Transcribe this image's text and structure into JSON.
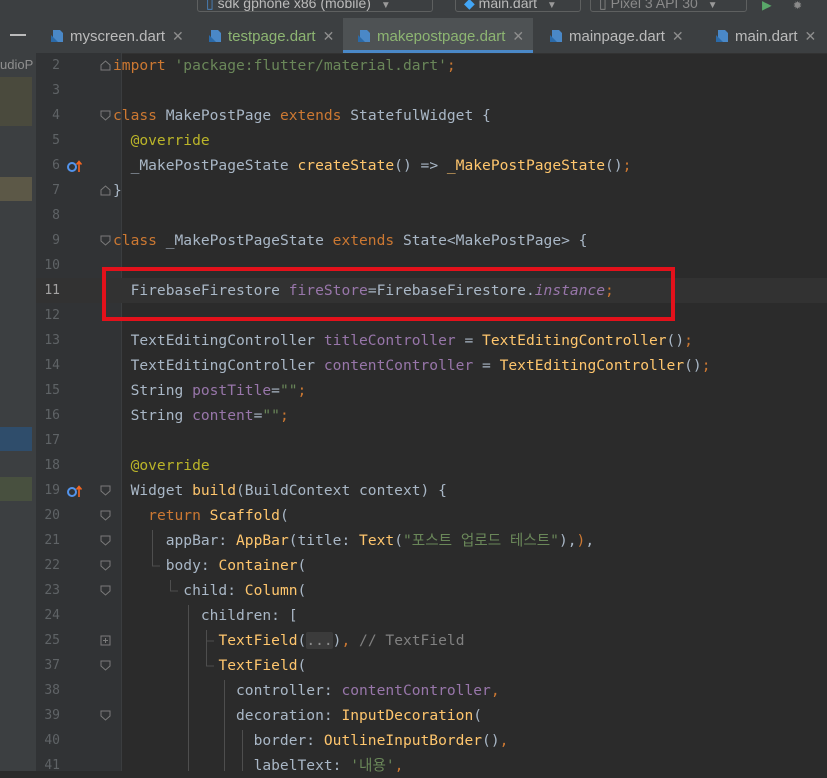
{
  "toolbar": {
    "device_label": "sdk gphone x86 (mobile)",
    "run_config_label": "main.dart",
    "avd_label": "Pixel 3 API 30"
  },
  "sidebar": {
    "project_label": "udioP"
  },
  "tabs": [
    {
      "label": "myscreen.dart",
      "active": false
    },
    {
      "label": "testpage.dart",
      "active": false
    },
    {
      "label": "makepostpage.dart",
      "active": true
    },
    {
      "label": "mainpage.dart",
      "active": false
    },
    {
      "label": "main.dart",
      "active": false
    }
  ],
  "editor": {
    "current_line": "11",
    "lines": [
      {
        "num": "2",
        "segments": [
          [
            "kw",
            "import "
          ],
          [
            "str",
            "'package:flutter/material.dart'"
          ],
          [
            "kw",
            ";"
          ]
        ]
      },
      {
        "num": "3",
        "segments": []
      },
      {
        "num": "4",
        "segments": [
          [
            "kw",
            "class "
          ],
          [
            "p",
            "MakePostPage "
          ],
          [
            "kw",
            "extends "
          ],
          [
            "p",
            "StatefulWidget {"
          ]
        ]
      },
      {
        "num": "5",
        "segments": [
          [
            "p",
            "  "
          ],
          [
            "ann",
            "@override"
          ]
        ]
      },
      {
        "num": "6",
        "segments": [
          [
            "p",
            "  _MakePostPageState "
          ],
          [
            "fn",
            "createState"
          ],
          [
            "p",
            "() => "
          ],
          [
            "fn",
            "_MakePostPageState"
          ],
          [
            "p",
            "()"
          ],
          [
            "kw",
            ";"
          ]
        ]
      },
      {
        "num": "7",
        "segments": [
          [
            "p",
            "}"
          ]
        ]
      },
      {
        "num": "8",
        "segments": []
      },
      {
        "num": "9",
        "segments": [
          [
            "kw",
            "class "
          ],
          [
            "p",
            "_MakePostPageState "
          ],
          [
            "kw",
            "extends "
          ],
          [
            "p",
            "State<MakePostPage> {"
          ]
        ]
      },
      {
        "num": "10",
        "segments": []
      },
      {
        "num": "11",
        "segments": [
          [
            "p",
            "  FirebaseFirestore "
          ],
          [
            "fld",
            "fireStore"
          ],
          [
            "p",
            "=FirebaseFirestore."
          ],
          [
            "fld-i",
            "instance"
          ],
          [
            "kw",
            ";"
          ]
        ]
      },
      {
        "num": "12",
        "segments": []
      },
      {
        "num": "13",
        "segments": [
          [
            "p",
            "  TextEditingController "
          ],
          [
            "fld",
            "titleController"
          ],
          [
            "p",
            " = "
          ],
          [
            "fn",
            "TextEditingController"
          ],
          [
            "p",
            "()"
          ],
          [
            "kw",
            ";"
          ]
        ]
      },
      {
        "num": "14",
        "segments": [
          [
            "p",
            "  TextEditingController "
          ],
          [
            "fld",
            "contentController"
          ],
          [
            "p",
            " = "
          ],
          [
            "fn",
            "TextEditingController"
          ],
          [
            "p",
            "()"
          ],
          [
            "kw",
            ";"
          ]
        ]
      },
      {
        "num": "15",
        "segments": [
          [
            "p",
            "  String "
          ],
          [
            "fld",
            "postTitle"
          ],
          [
            "p",
            "="
          ],
          [
            "str",
            "\"\""
          ],
          [
            "kw",
            ";"
          ]
        ]
      },
      {
        "num": "16",
        "segments": [
          [
            "p",
            "  String "
          ],
          [
            "fld",
            "content"
          ],
          [
            "p",
            "="
          ],
          [
            "str",
            "\"\""
          ],
          [
            "kw",
            ";"
          ]
        ]
      },
      {
        "num": "17",
        "segments": []
      },
      {
        "num": "18",
        "segments": [
          [
            "p",
            "  "
          ],
          [
            "ann",
            "@override"
          ]
        ]
      },
      {
        "num": "19",
        "segments": [
          [
            "p",
            "  Widget "
          ],
          [
            "fn",
            "build"
          ],
          [
            "p",
            "(BuildContext context) {"
          ]
        ]
      },
      {
        "num": "20",
        "segments": [
          [
            "p",
            "    "
          ],
          [
            "kw",
            "return "
          ],
          [
            "fn",
            "Scaffold"
          ],
          [
            "p",
            "("
          ]
        ]
      },
      {
        "num": "21",
        "segments": [
          [
            "p",
            "      appBar: "
          ],
          [
            "fn",
            "AppBar"
          ],
          [
            "p",
            "(title: "
          ],
          [
            "fn",
            "Text"
          ],
          [
            "p",
            "("
          ],
          [
            "str",
            "\"포스트 업로드 테스트\""
          ],
          [
            "p",
            "),"
          ],
          [
            "kw",
            ")"
          ],
          [
            "p",
            ","
          ]
        ]
      },
      {
        "num": "22",
        "segments": [
          [
            "p",
            "      body: "
          ],
          [
            "fn",
            "Container"
          ],
          [
            "p",
            "("
          ]
        ]
      },
      {
        "num": "23",
        "segments": [
          [
            "p",
            "        child: "
          ],
          [
            "fn",
            "Column"
          ],
          [
            "p",
            "("
          ]
        ]
      },
      {
        "num": "24",
        "segments": [
          [
            "p",
            "          children: ["
          ]
        ]
      },
      {
        "num": "25",
        "segments": [
          [
            "p",
            "            "
          ],
          [
            "fn",
            "TextField"
          ],
          [
            "p",
            "("
          ],
          [
            "fold",
            "..."
          ],
          [
            "p",
            ")"
          ],
          [
            "kw",
            ","
          ],
          [
            "cmt",
            " // TextField"
          ]
        ]
      },
      {
        "num": "37",
        "segments": [
          [
            "p",
            "            "
          ],
          [
            "fn",
            "TextField"
          ],
          [
            "p",
            "("
          ]
        ]
      },
      {
        "num": "38",
        "segments": [
          [
            "p",
            "              controller: "
          ],
          [
            "fld",
            "contentController"
          ],
          [
            "kw",
            ","
          ]
        ]
      },
      {
        "num": "39",
        "segments": [
          [
            "p",
            "              decoration: "
          ],
          [
            "fn",
            "InputDecoration"
          ],
          [
            "p",
            "("
          ]
        ]
      },
      {
        "num": "40",
        "segments": [
          [
            "p",
            "                border: "
          ],
          [
            "fn",
            "OutlineInputBorder"
          ],
          [
            "p",
            "()"
          ],
          [
            "kw",
            ","
          ]
        ]
      },
      {
        "num": "41",
        "segments": [
          [
            "p",
            "                labelText: "
          ],
          [
            "str",
            "'내용'"
          ],
          [
            "kw",
            ","
          ]
        ]
      }
    ],
    "fold_markers": {
      "2": "end",
      "4": "start",
      "7": "end",
      "9": "start",
      "19": "start",
      "20": "start",
      "21": "start",
      "22": "start",
      "23": "start",
      "25": "plus",
      "37": "start",
      "39": "start"
    },
    "override_markers": [
      "6",
      "19"
    ]
  },
  "colors": {
    "keyword": "#cc7832",
    "string": "#6a8759",
    "field": "#9876aa",
    "function": "#ffc66d",
    "annotation": "#bbb529",
    "plain": "#a9b7c6",
    "highlight_box": "#e3111b",
    "active_tab_underline": "#4a88c7"
  }
}
